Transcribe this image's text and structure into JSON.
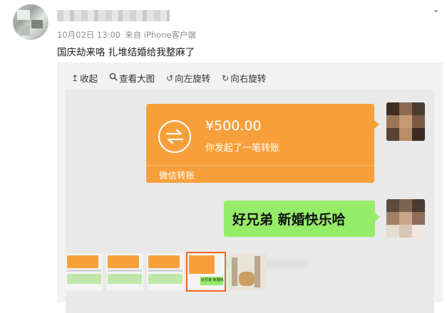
{
  "post": {
    "date": "10月02日 13:00",
    "source": "来自 iPhone客户端",
    "text": "国庆劫来咯 扎堆结婚给我整麻了"
  },
  "header": {
    "menu_icon": "chevron-down-icon"
  },
  "toolbar": {
    "collapse": "收起",
    "view_large": "查看大图",
    "rotate_left": "向左旋转",
    "rotate_right": "向右旋转"
  },
  "chat": {
    "transfer": {
      "amount": "¥500.00",
      "description": "你发起了一笔转账",
      "footer": "微信转账"
    },
    "message": "好兄弟 新婚快乐哈"
  },
  "thumbnails": {
    "count": 5,
    "selected_index": 3,
    "selected_message": "好兄弟 新婚快"
  },
  "colors": {
    "transfer_orange": "#f7a03b",
    "bubble_green": "#95ec69",
    "selected_border": "#f26522"
  }
}
